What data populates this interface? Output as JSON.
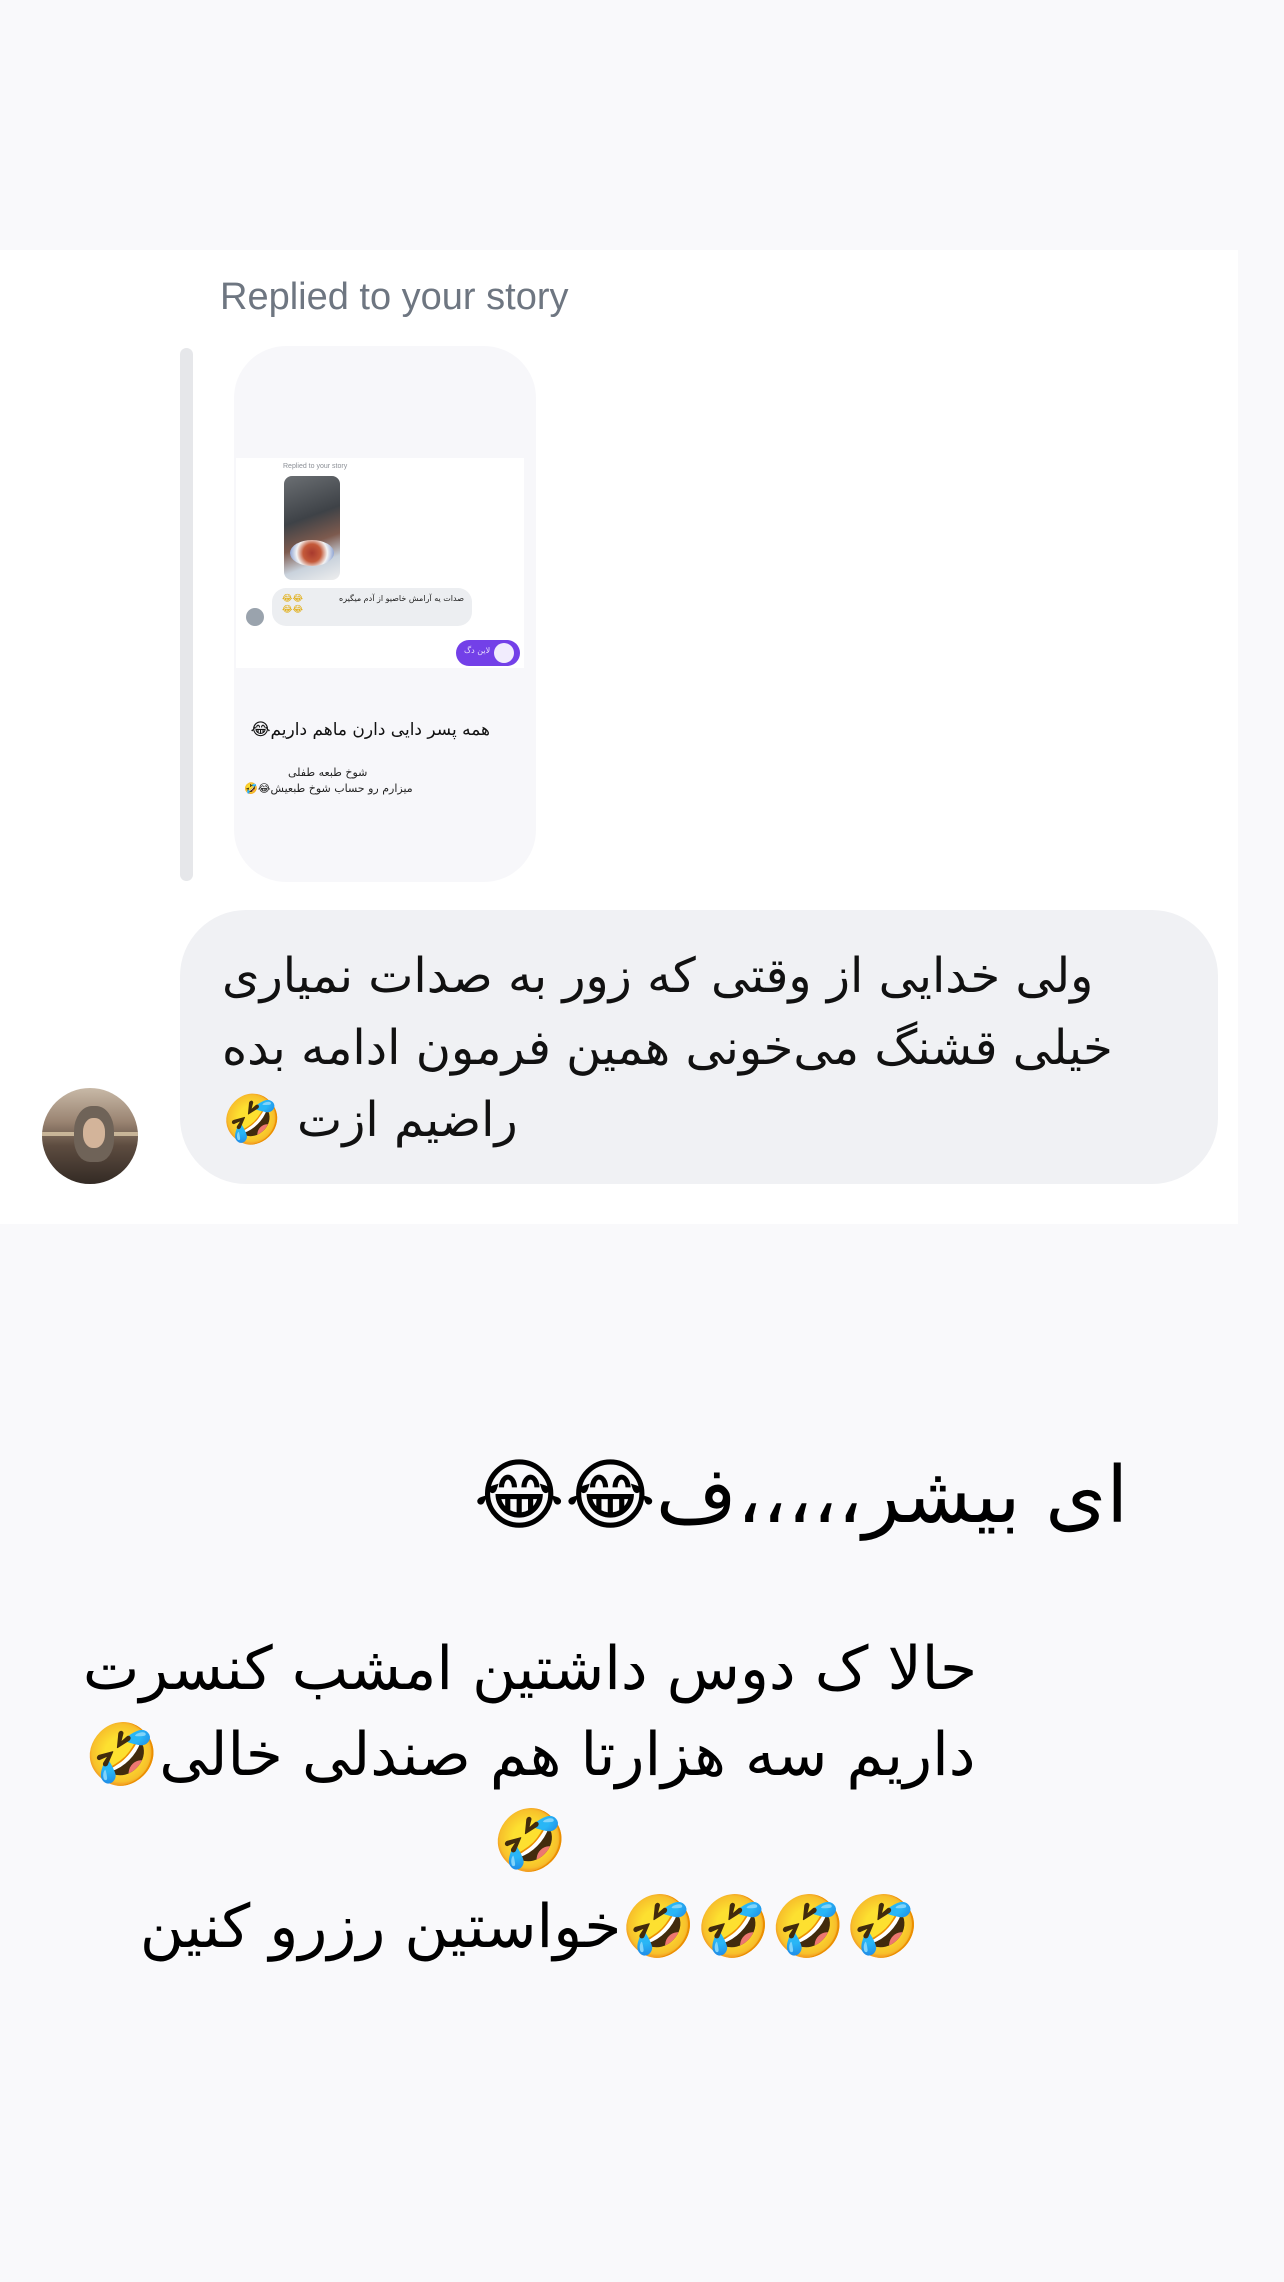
{
  "reply": {
    "caption": "Replied to your story"
  },
  "story_preview": {
    "inner_caption": "Replied to your story",
    "inner_message": "صدات یه آرامش خاصیو از آدم میگیره",
    "inner_message_emoji": "😂😂😂😂",
    "inner_sent": "لاین دگ",
    "line1": "همه پسر دایی دارن ماهم داریم😂",
    "line2": "شوخ طبعه طفلی",
    "line3": "میزارم رو حساب شوخ طبعیش😂🤣"
  },
  "message": {
    "text": "ولی خدایی از وقتی که زور به صدات نمیاری\nخیلی قشنگ می‌خونی همین فرمون ادامه بده\nراضیم ازت 🤣"
  },
  "overlay": {
    "heading": "ای بیشر،،،،،ف😂😂",
    "paragraph": "حالا ک دوس داشتین امشب کنسرت\nداریم سه هزارتا هم صندلی خالی🤣🤣\n🤣🤣🤣🤣خواستین رزرو کنین"
  }
}
